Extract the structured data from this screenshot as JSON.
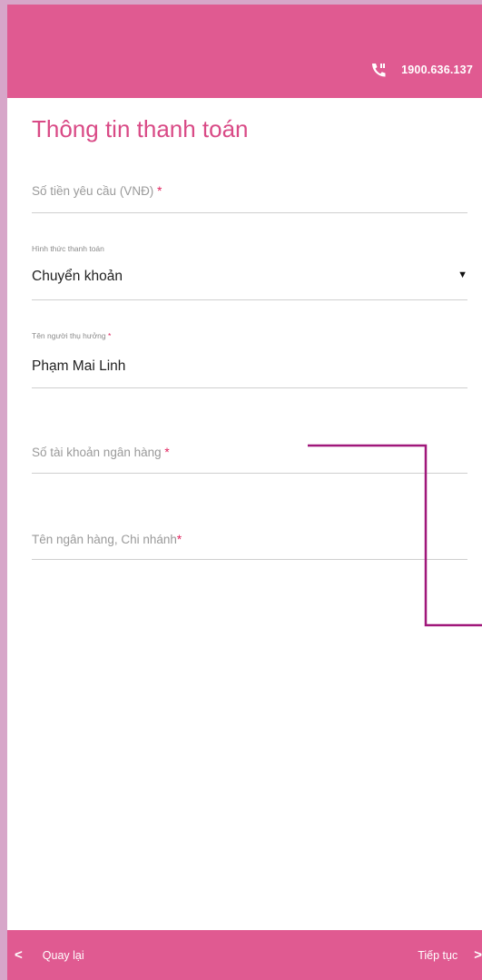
{
  "header": {
    "hotline_number": "1900.636.137",
    "hotline_icon": "phone-icon"
  },
  "form": {
    "title": "Thông tin thanh toán",
    "amount": {
      "placeholder": "Số tiền yêu cầu (VNĐ)",
      "required_mark": "*"
    },
    "payment_method": {
      "label": "Hình thức thanh toán",
      "value": "Chuyển khoản"
    },
    "beneficiary": {
      "label": "Tên người thụ hưởng",
      "required_mark": "*",
      "value": "Phạm Mai Linh"
    },
    "account_number": {
      "placeholder": "Số tài khoản ngân hàng",
      "required_mark": "*"
    },
    "bank_name": {
      "placeholder": "Tên ngân hàng, Chi nhánh",
      "required_mark": "*"
    }
  },
  "footer": {
    "back_label": "Quay lại",
    "next_label": "Tiếp tục"
  },
  "colors": {
    "brand": "#e05a91",
    "title": "#d94a86",
    "required": "#e0245e",
    "annotation": "#a0177a"
  }
}
